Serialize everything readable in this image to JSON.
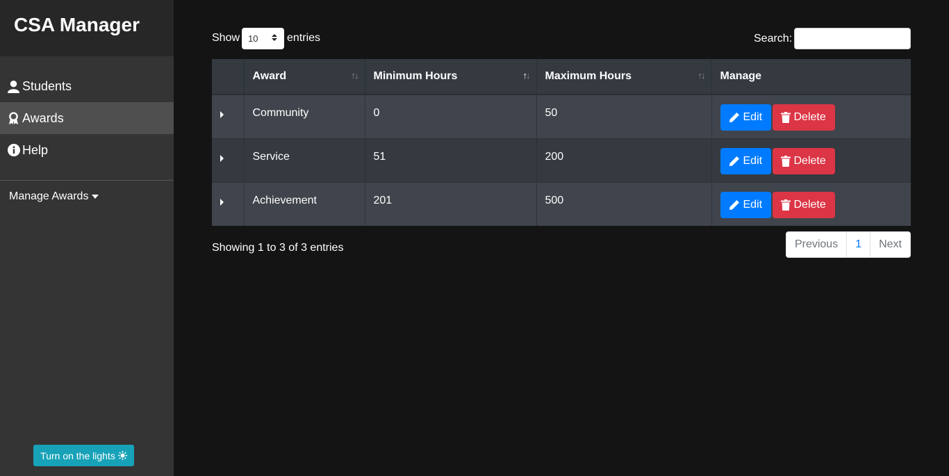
{
  "app": {
    "title": "CSA Manager"
  },
  "sidebar": {
    "items": [
      {
        "label": "Students",
        "icon": "user-icon"
      },
      {
        "label": "Awards",
        "icon": "award-icon",
        "active": true
      },
      {
        "label": "Help",
        "icon": "info-circle-icon"
      }
    ],
    "manage_dropdown": "Manage Awards",
    "lights_button": "Turn on the lights"
  },
  "table_controls": {
    "show_label": "Show",
    "page_length": "10",
    "entries_label": "entries",
    "search_label": "Search:",
    "search_value": ""
  },
  "table": {
    "headers": [
      "Award",
      "Minimum Hours",
      "Maximum Hours",
      "Manage"
    ],
    "sorted_column": "Minimum Hours",
    "rows": [
      {
        "award": "Community",
        "min": "0",
        "max": "50"
      },
      {
        "award": "Service",
        "min": "51",
        "max": "200"
      },
      {
        "award": "Achievement",
        "min": "201",
        "max": "500"
      }
    ],
    "edit_label": "Edit",
    "delete_label": "Delete"
  },
  "footer": {
    "info": "Showing 1 to 3 of 3 entries",
    "previous": "Previous",
    "current_page": "1",
    "next": "Next"
  },
  "colors": {
    "edit": "#007bff",
    "delete": "#dc3545",
    "lights": "#17a2b8"
  }
}
